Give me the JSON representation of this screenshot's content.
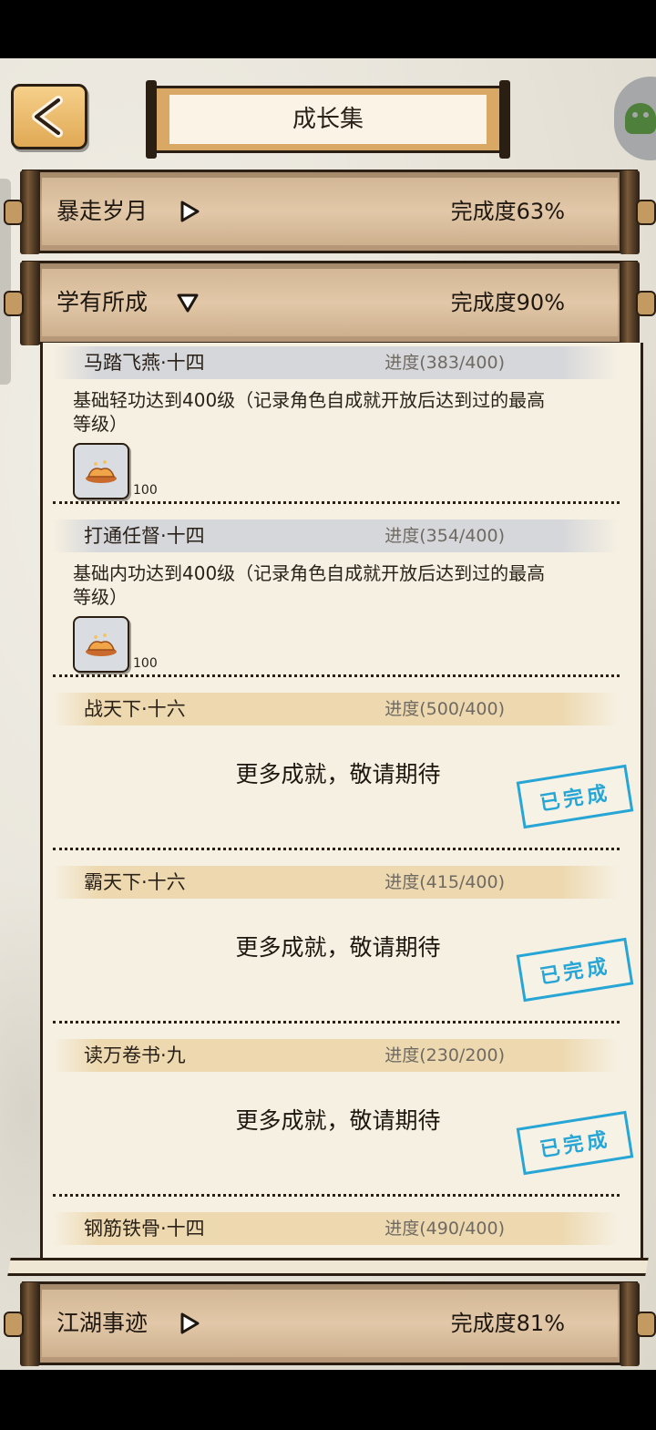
{
  "header": {
    "title": "成长集",
    "back_icon": "chevron-left-icon"
  },
  "categories": [
    {
      "name": "暴走岁月",
      "state": "collapsed",
      "progress_label": "完成度63%"
    },
    {
      "name": "学有所成",
      "state": "expanded",
      "progress_label": "完成度90%"
    },
    {
      "name": "江湖事迹",
      "state": "collapsed",
      "progress_label": "完成度81%"
    }
  ],
  "achievements": [
    {
      "name": "马踏飞燕·十四",
      "progress": "进度(383/400)",
      "description": "基础轻功达到400级（记录角色自成就开放后达到过的最高等级）",
      "reward_count": "100",
      "completed": false
    },
    {
      "name": "打通任督·十四",
      "progress": "进度(354/400)",
      "description": "基础内功达到400级（记录角色自成就开放后达到过的最高等级）",
      "reward_count": "100",
      "completed": false
    },
    {
      "name": "战天下·十六",
      "progress": "进度(500/400)",
      "message": "更多成就，敬请期待",
      "stamp": "已完成",
      "completed": true
    },
    {
      "name": "霸天下·十六",
      "progress": "进度(415/400)",
      "message": "更多成就，敬请期待",
      "stamp": "已完成",
      "completed": true
    },
    {
      "name": "读万卷书·九",
      "progress": "进度(230/200)",
      "message": "更多成就，敬请期待",
      "stamp": "已完成",
      "completed": true
    },
    {
      "name": "钢筋铁骨·十四",
      "progress": "进度(490/400)",
      "completed": false
    }
  ],
  "colors": {
    "stamp": "#27a6d6",
    "bar": "#c8a987",
    "paper": "#f6f0e2"
  }
}
